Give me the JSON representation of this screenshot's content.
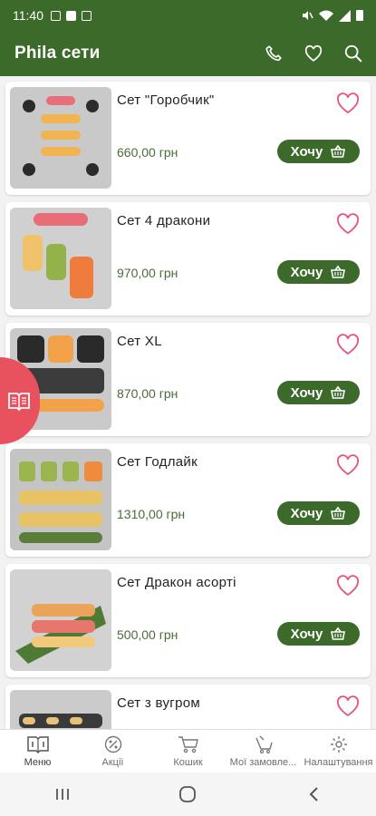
{
  "status_bar": {
    "time": "11:40",
    "icons_left": [
      "gallery-icon",
      "grid-icon",
      "media-icon"
    ],
    "icons_right": [
      "mute-icon",
      "wifi-icon",
      "signal-icon",
      "battery-icon"
    ]
  },
  "app_bar": {
    "title": "Phila сети",
    "actions": [
      "phone-icon",
      "heart-icon",
      "search-icon"
    ]
  },
  "colors": {
    "primary": "#3b6a2a",
    "price": "#4b6b3a",
    "favorite": "#e8527a",
    "menu_tab": "#e8525f",
    "list_bg": "#f2f2f2"
  },
  "products": [
    {
      "name": "Сет \"Горобчик\"",
      "price": "660,00 грн",
      "cta": "Хочу"
    },
    {
      "name": "Сет 4 дракони",
      "price": "970,00 грн",
      "cta": "Хочу"
    },
    {
      "name": "Сет XL",
      "price": "870,00 грн",
      "cta": "Хочу"
    },
    {
      "name": "Сет Годлайк",
      "price": "1310,00 грн",
      "cta": "Хочу"
    },
    {
      "name": "Сет Дракон асорті",
      "price": "500,00 грн",
      "cta": "Хочу"
    },
    {
      "name": "Сет з вугром",
      "price": "",
      "cta": ""
    }
  ],
  "bottom_nav": {
    "items": [
      {
        "label": "Меню",
        "icon": "menu-book-icon",
        "active": true
      },
      {
        "label": "Акції",
        "icon": "percent-icon",
        "active": false
      },
      {
        "label": "Кошик",
        "icon": "cart-icon",
        "active": false
      },
      {
        "label": "Мої замовле...",
        "icon": "orders-icon",
        "active": false
      },
      {
        "label": "Налаштування",
        "icon": "settings-icon",
        "active": false
      }
    ]
  },
  "system_nav": [
    "recents-icon",
    "home-icon",
    "back-icon"
  ]
}
